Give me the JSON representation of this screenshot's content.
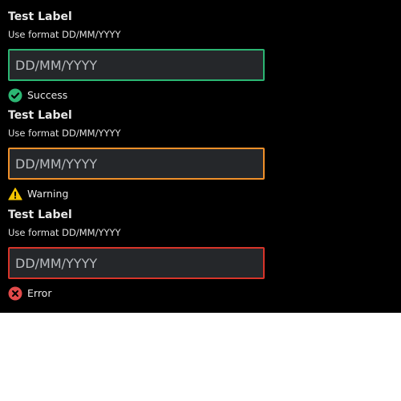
{
  "colors": {
    "success": "#2cb673",
    "warning": "#f0902a",
    "error": "#d8352a",
    "warning_icon": "#f5c400",
    "error_icon": "#e24a4a"
  },
  "fields": [
    {
      "label": "Test Label",
      "helper": "Use format DD/MM/YYYY",
      "placeholder": "DD/MM/YYYY",
      "value": "",
      "status_icon": "check-circle-icon",
      "status_text": "Success"
    },
    {
      "label": "Test Label",
      "helper": "Use format DD/MM/YYYY",
      "placeholder": "DD/MM/YYYY",
      "value": "",
      "status_icon": "warning-triangle-icon",
      "status_text": "Warning"
    },
    {
      "label": "Test Label",
      "helper": "Use format DD/MM/YYYY",
      "placeholder": "DD/MM/YYYY",
      "value": "",
      "status_icon": "error-circle-icon",
      "status_text": "Error"
    }
  ]
}
